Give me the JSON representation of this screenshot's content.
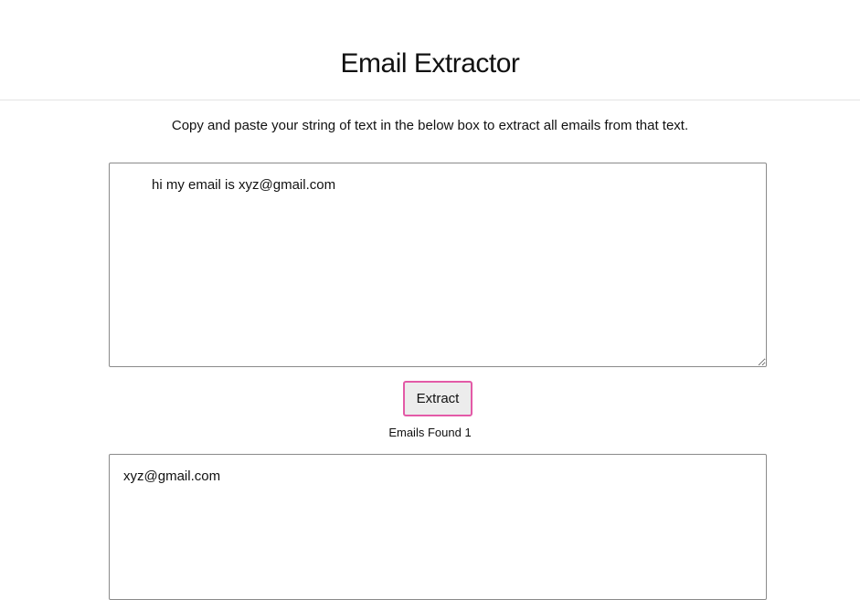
{
  "header": {
    "title": "Email Extractor"
  },
  "instructions": "Copy and paste your string of text in the below box to extract all emails from that text.",
  "input": {
    "value": "hi my email is xyz@gmail.com",
    "placeholder": ""
  },
  "actions": {
    "extract_label": "Extract"
  },
  "results": {
    "count_label": "Emails Found",
    "count": 1,
    "value": "xyz@gmail.com"
  },
  "colors": {
    "button_border": "#e35aa7",
    "button_background": "#ececec",
    "box_border": "#8a8a8a",
    "header_rule": "#e3e3e3"
  }
}
